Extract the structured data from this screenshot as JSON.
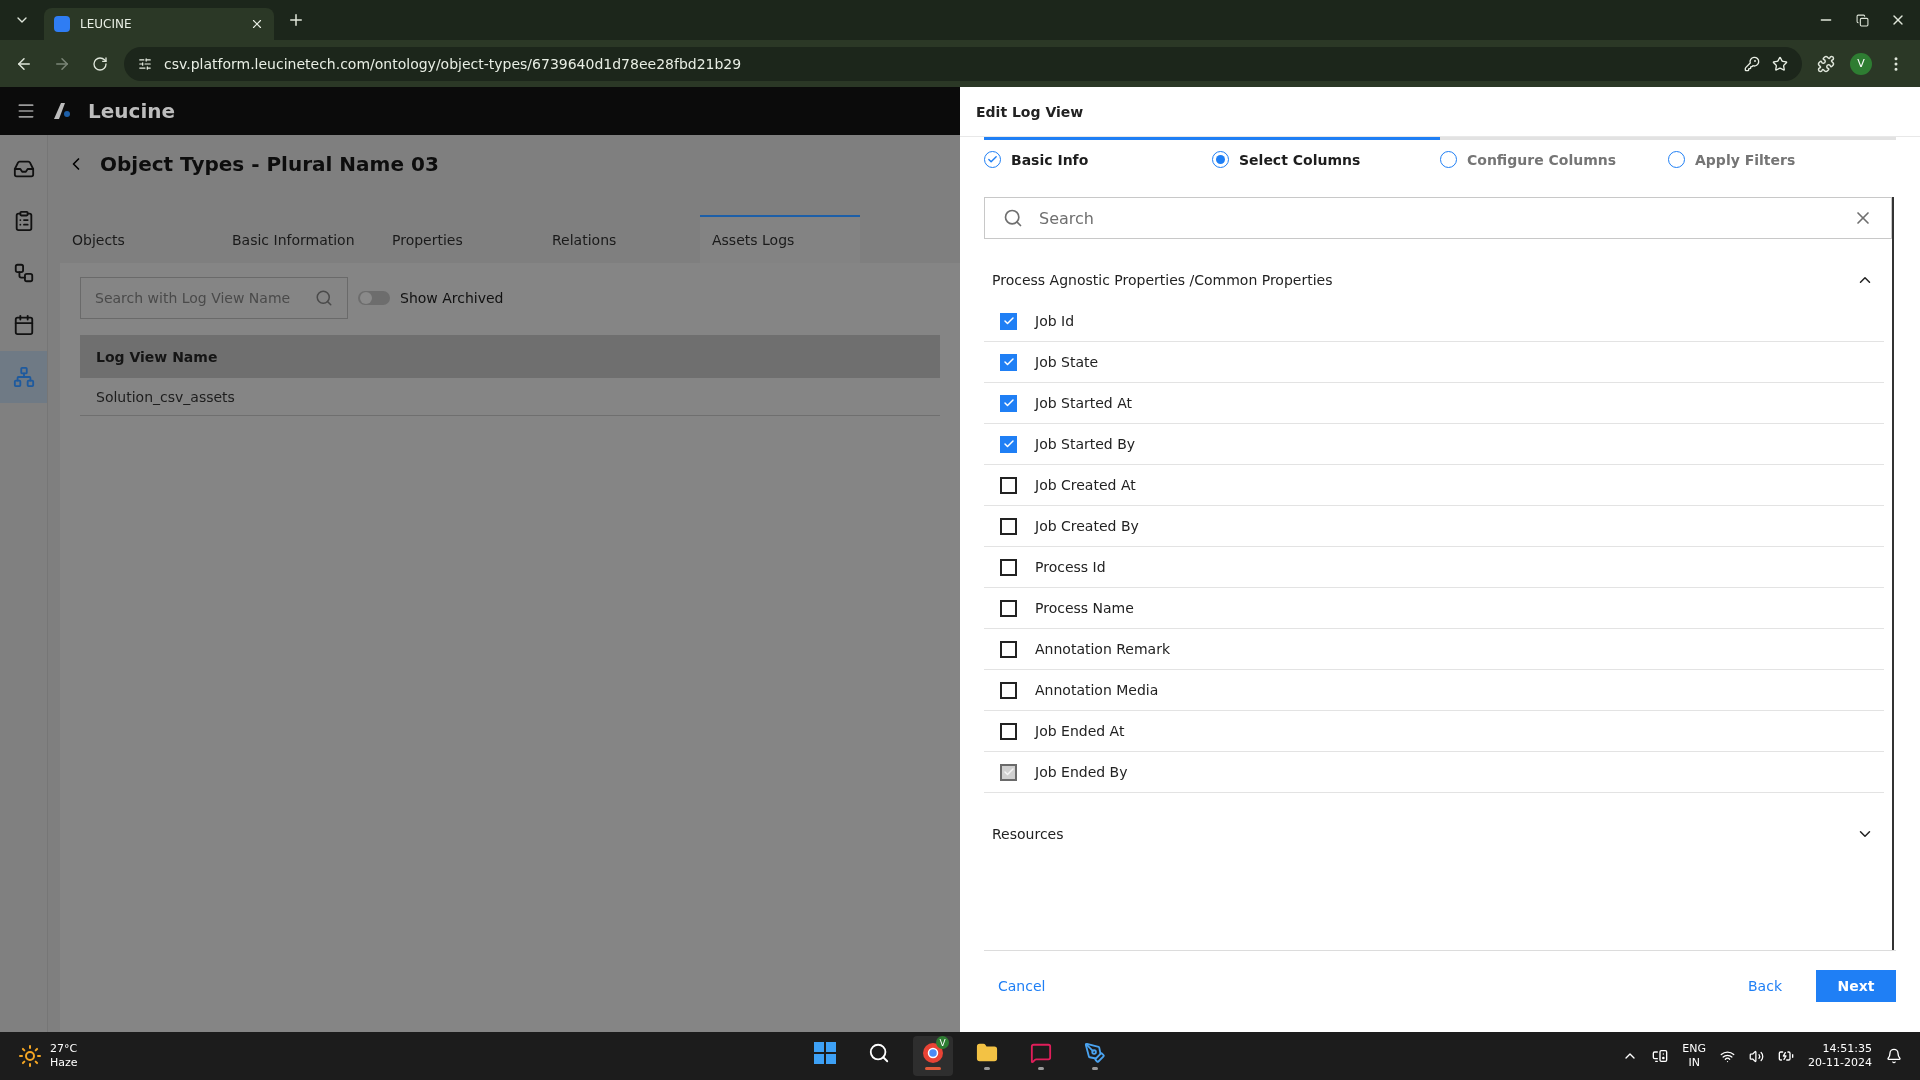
{
  "browser": {
    "tab_title": "LEUCINE",
    "url": "csv.platform.leucinetech.com/ontology/object-types/6739640d1d78ee28fbd21b29",
    "profile": "V"
  },
  "app": {
    "brand": "Leucine",
    "sidebar": [
      {
        "kind": "inbox",
        "selected": false
      },
      {
        "kind": "checklist",
        "selected": false
      },
      {
        "kind": "workflow",
        "selected": false
      },
      {
        "kind": "calendar",
        "selected": false
      },
      {
        "kind": "hierarchy",
        "selected": true
      }
    ]
  },
  "page": {
    "title": "Object Types - Plural Name 03",
    "tabs": [
      {
        "label": "Objects",
        "selected": false
      },
      {
        "label": "Basic Information",
        "selected": false
      },
      {
        "label": "Properties",
        "selected": false
      },
      {
        "label": "Relations",
        "selected": false
      },
      {
        "label": "Assets Logs",
        "selected": true
      }
    ],
    "search": {
      "placeholder": "Search with Log View Name"
    },
    "toggle": {
      "label": "Show Archived",
      "on": false
    },
    "table": {
      "columns": [
        "Log View Name"
      ],
      "rows": [
        [
          "Solution_csv_assets"
        ]
      ]
    }
  },
  "drawer": {
    "title": "Edit Log View",
    "steps": [
      {
        "label": "Basic Info",
        "completed": true,
        "selected": false
      },
      {
        "label": "Select Columns",
        "completed": false,
        "selected": true
      },
      {
        "label": "Configure Columns",
        "completed": false,
        "selected": false
      },
      {
        "label": "Apply Filters",
        "completed": false,
        "selected": false
      }
    ],
    "search": {
      "placeholder": "Search"
    },
    "sections": [
      {
        "title": "Process Agnostic Properties /Common Properties",
        "expanded": true,
        "items": [
          {
            "label": "Job Id",
            "checked": true,
            "disabled": false
          },
          {
            "label": "Job State",
            "checked": true,
            "disabled": false
          },
          {
            "label": "Job Started At",
            "checked": true,
            "disabled": false
          },
          {
            "label": "Job Started By",
            "checked": true,
            "disabled": false
          },
          {
            "label": "Job Created At",
            "checked": false,
            "disabled": false
          },
          {
            "label": "Job Created By",
            "checked": false,
            "disabled": false
          },
          {
            "label": "Process Id",
            "checked": false,
            "disabled": false
          },
          {
            "label": "Process Name",
            "checked": false,
            "disabled": false
          },
          {
            "label": "Annotation Remark",
            "checked": false,
            "disabled": false
          },
          {
            "label": "Annotation Media",
            "checked": false,
            "disabled": false
          },
          {
            "label": "Job Ended At",
            "checked": false,
            "disabled": false
          },
          {
            "label": "Job Ended By",
            "checked": true,
            "disabled": true
          }
        ]
      },
      {
        "title": "Resources",
        "expanded": false
      }
    ],
    "footer": {
      "cancel": "Cancel",
      "back": "Back",
      "next": "Next"
    }
  },
  "taskbar": {
    "weather": {
      "temp": "27°C",
      "condition": "Haze"
    },
    "apps": [
      {
        "kind": "start",
        "active": false,
        "running": false
      },
      {
        "kind": "search",
        "active": false,
        "running": false
      },
      {
        "kind": "browser",
        "active": true,
        "running": true,
        "badge": "V"
      },
      {
        "kind": "folder",
        "active": false,
        "running": true
      },
      {
        "kind": "chat",
        "active": false,
        "running": true
      },
      {
        "kind": "editor",
        "active": false,
        "running": true
      }
    ],
    "language": [
      "ENG",
      "IN"
    ],
    "time": "14:51:35",
    "date": "20-11-2024"
  }
}
